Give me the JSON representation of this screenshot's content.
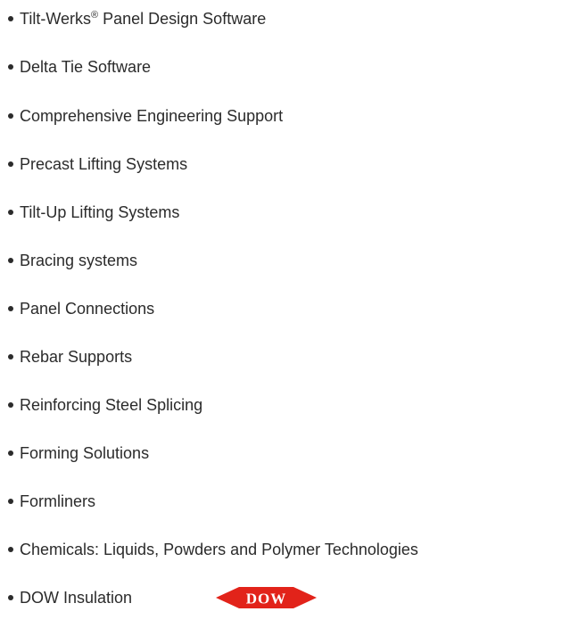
{
  "list": {
    "items": [
      {
        "label": "Tilt-Werks",
        "reg_mark": "®",
        "suffix": " Panel Design Software"
      },
      {
        "label": "Delta Tie Software"
      },
      {
        "label": "Comprehensive Engineering Support"
      },
      {
        "label": "Precast Lifting Systems"
      },
      {
        "label": "Tilt-Up Lifting Systems"
      },
      {
        "label": "Bracing systems"
      },
      {
        "label": "Panel Connections"
      },
      {
        "label": "Rebar Supports"
      },
      {
        "label": "Reinforcing Steel Splicing"
      },
      {
        "label": "Forming Solutions"
      },
      {
        "label": "Formliners"
      },
      {
        "label": "Chemicals: Liquids, Powders and Polymer Technologies"
      },
      {
        "label": "DOW Insulation"
      }
    ]
  },
  "logo": {
    "text": "DOW",
    "icon": "dow-logo-icon",
    "color": "#e2231a"
  },
  "colors": {
    "text": "#2b2b2b",
    "background": "#ffffff"
  }
}
